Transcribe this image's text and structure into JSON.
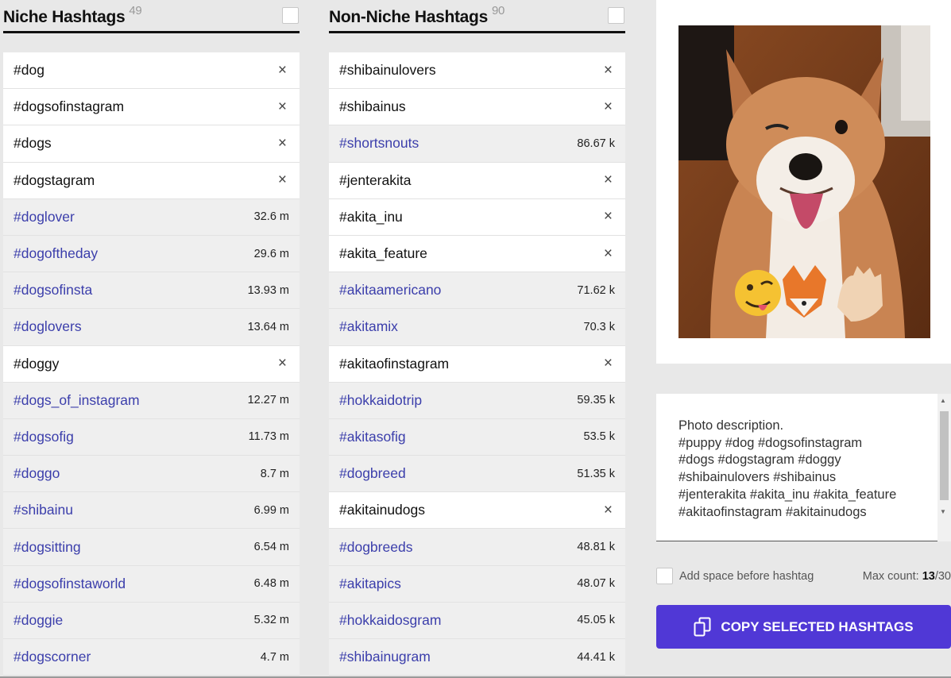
{
  "niche": {
    "title": "Niche Hashtags",
    "count": "49",
    "items": [
      {
        "tag": "#dog",
        "selected": true,
        "meta": "×"
      },
      {
        "tag": "#dogsofinstagram",
        "selected": true,
        "meta": "×"
      },
      {
        "tag": "#dogs",
        "selected": true,
        "meta": "×"
      },
      {
        "tag": "#dogstagram",
        "selected": true,
        "meta": "×"
      },
      {
        "tag": "#doglover",
        "selected": false,
        "meta": "32.6 m"
      },
      {
        "tag": "#dogoftheday",
        "selected": false,
        "meta": "29.6 m"
      },
      {
        "tag": "#dogsofinsta",
        "selected": false,
        "meta": "13.93 m"
      },
      {
        "tag": "#doglovers",
        "selected": false,
        "meta": "13.64 m"
      },
      {
        "tag": "#doggy",
        "selected": true,
        "meta": "×"
      },
      {
        "tag": "#dogs_of_instagram",
        "selected": false,
        "meta": "12.27 m"
      },
      {
        "tag": "#dogsofig",
        "selected": false,
        "meta": "11.73 m"
      },
      {
        "tag": "#doggo",
        "selected": false,
        "meta": "8.7 m"
      },
      {
        "tag": "#shibainu",
        "selected": false,
        "meta": "6.99 m"
      },
      {
        "tag": "#dogsitting",
        "selected": false,
        "meta": "6.54 m"
      },
      {
        "tag": "#dogsofinstaworld",
        "selected": false,
        "meta": "6.48 m"
      },
      {
        "tag": "#doggie",
        "selected": false,
        "meta": "5.32 m"
      },
      {
        "tag": "#dogscorner",
        "selected": false,
        "meta": "4.7 m"
      }
    ]
  },
  "nonniche": {
    "title": "Non-Niche Hashtags",
    "count": "90",
    "items": [
      {
        "tag": "#shibainulovers",
        "selected": true,
        "meta": "×"
      },
      {
        "tag": "#shibainus",
        "selected": true,
        "meta": "×"
      },
      {
        "tag": "#shortsnouts",
        "selected": false,
        "meta": "86.67 k"
      },
      {
        "tag": "#jenterakita",
        "selected": true,
        "meta": "×"
      },
      {
        "tag": "#akita_inu",
        "selected": true,
        "meta": "×"
      },
      {
        "tag": "#akita_feature",
        "selected": true,
        "meta": "×"
      },
      {
        "tag": "#akitaamericano",
        "selected": false,
        "meta": "71.62 k"
      },
      {
        "tag": "#akitamix",
        "selected": false,
        "meta": "70.3 k"
      },
      {
        "tag": "#akitaofinstagram",
        "selected": true,
        "meta": "×"
      },
      {
        "tag": "#hokkaidotrip",
        "selected": false,
        "meta": "59.35 k"
      },
      {
        "tag": "#akitasofig",
        "selected": false,
        "meta": "53.5 k"
      },
      {
        "tag": "#dogbreed",
        "selected": false,
        "meta": "51.35 k"
      },
      {
        "tag": "#akitainudogs",
        "selected": true,
        "meta": "×"
      },
      {
        "tag": "#dogbreeds",
        "selected": false,
        "meta": "48.81 k"
      },
      {
        "tag": "#akitapics",
        "selected": false,
        "meta": "48.07 k"
      },
      {
        "tag": "#hokkaidosgram",
        "selected": false,
        "meta": "45.05 k"
      },
      {
        "tag": "#shibainugram",
        "selected": false,
        "meta": "44.41 k"
      }
    ]
  },
  "description": {
    "text": "Photo description.\n#puppy #dog #dogsofinstagram\n#dogs #dogstagram #doggy\n#shibainulovers #shibainus\n#jenterakita #akita_inu #akita_feature\n#akitaofinstagram #akitainudogs"
  },
  "options": {
    "space_label": "Add space before hashtag",
    "max_label": "Max count: ",
    "max_value": "13",
    "max_total": "/30"
  },
  "copy_button": {
    "label": "COPY SELECTED HASHTAGS"
  },
  "colors": {
    "accent": "#5038d6",
    "link": "#3b3eab"
  }
}
